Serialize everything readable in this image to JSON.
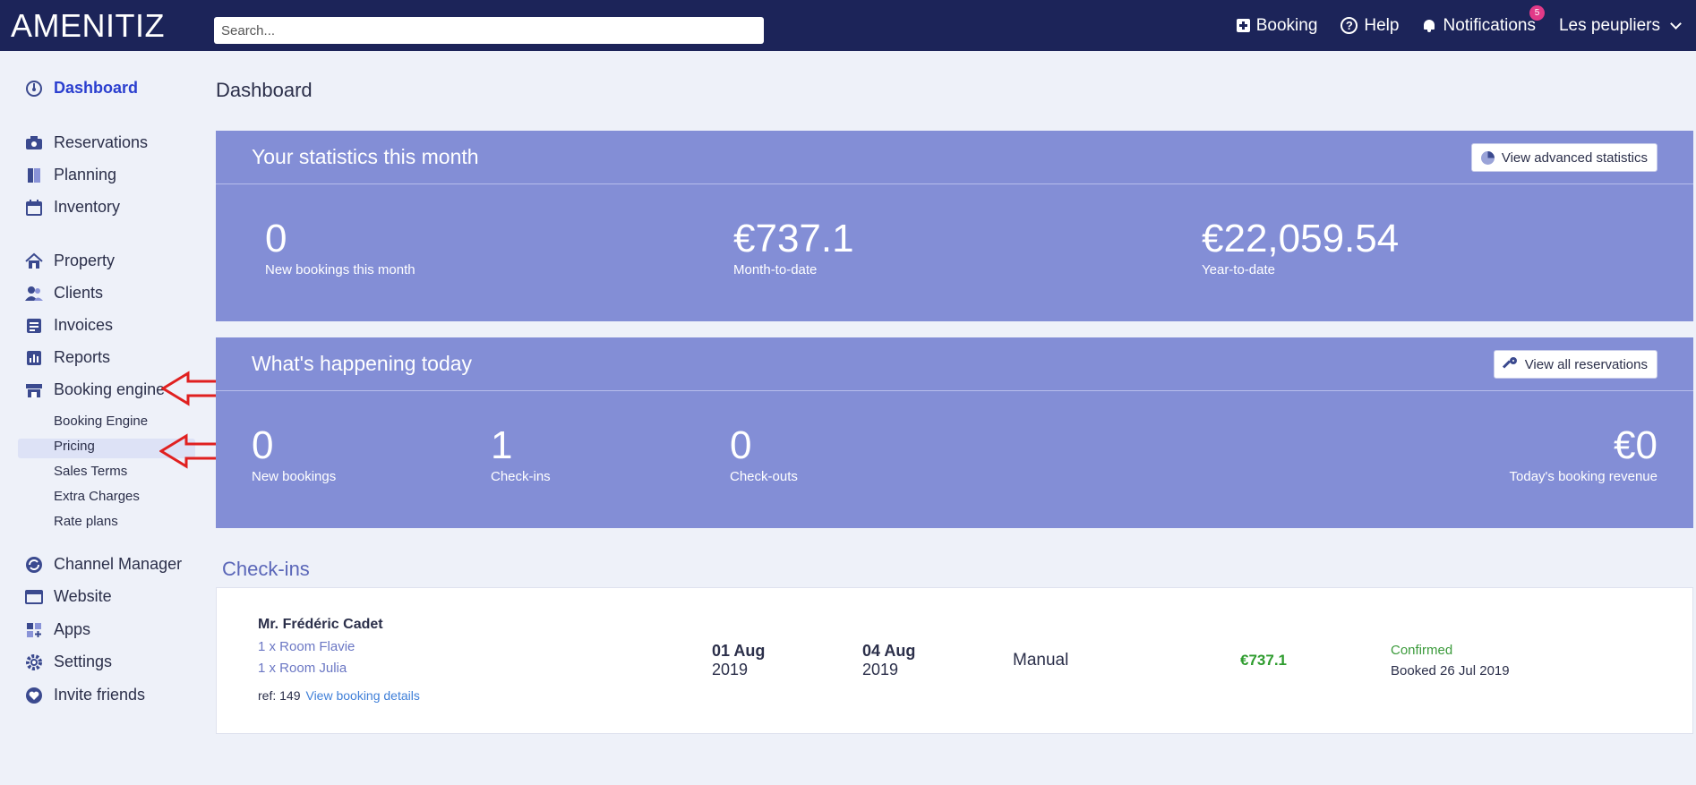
{
  "topbar": {
    "logo": "AMENITIZ",
    "search_placeholder": "Search...",
    "booking_label": "Booking",
    "help_label": "Help",
    "notifications_label": "Notifications",
    "notifications_count": "5",
    "property_name": "Les peupliers"
  },
  "sidebar": {
    "dashboard": "Dashboard",
    "reservations": "Reservations",
    "planning": "Planning",
    "inventory": "Inventory",
    "property": "Property",
    "clients": "Clients",
    "invoices": "Invoices",
    "reports": "Reports",
    "booking_engine": "Booking engine",
    "sub": {
      "booking_engine": "Booking Engine",
      "pricing": "Pricing",
      "sales_terms": "Sales Terms",
      "extra_charges": "Extra Charges",
      "rate_plans": "Rate plans"
    },
    "channel_manager": "Channel Manager",
    "website": "Website",
    "apps": "Apps",
    "settings": "Settings",
    "invite_friends": "Invite friends"
  },
  "main": {
    "page_title": "Dashboard",
    "stats_month": {
      "title": "Your statistics this month",
      "button": "View advanced statistics",
      "items": [
        {
          "value": "0",
          "label": "New bookings this month"
        },
        {
          "value": "€737.1",
          "label": "Month-to-date"
        },
        {
          "value": "€22,059.54",
          "label": "Year-to-date"
        }
      ]
    },
    "today": {
      "title": "What's happening today",
      "button": "View all reservations",
      "items": [
        {
          "value": "0",
          "label": "New bookings"
        },
        {
          "value": "1",
          "label": "Check-ins"
        },
        {
          "value": "0",
          "label": "Check-outs"
        },
        {
          "value": "€0",
          "label": "Today's booking revenue"
        }
      ]
    },
    "checkins": {
      "title": "Check-ins",
      "row": {
        "guest": "Mr. Frédéric Cadet",
        "rooms": [
          "1 x Room Flavie",
          "1 x Room Julia"
        ],
        "ref_label": "ref: 149",
        "details_link": "View booking details",
        "arrival_day": "01 Aug",
        "arrival_year": "2019",
        "departure_day": "04 Aug",
        "departure_year": "2019",
        "source": "Manual",
        "price": "€737.1",
        "status": "Confirmed",
        "booked": "Booked 26 Jul 2019"
      }
    }
  },
  "colors": {
    "topbar": "#1c2459",
    "panel": "#838ed6",
    "accent": "#2b3fcf",
    "confirmed": "#3b9a3b",
    "arrow": "#e02020"
  }
}
